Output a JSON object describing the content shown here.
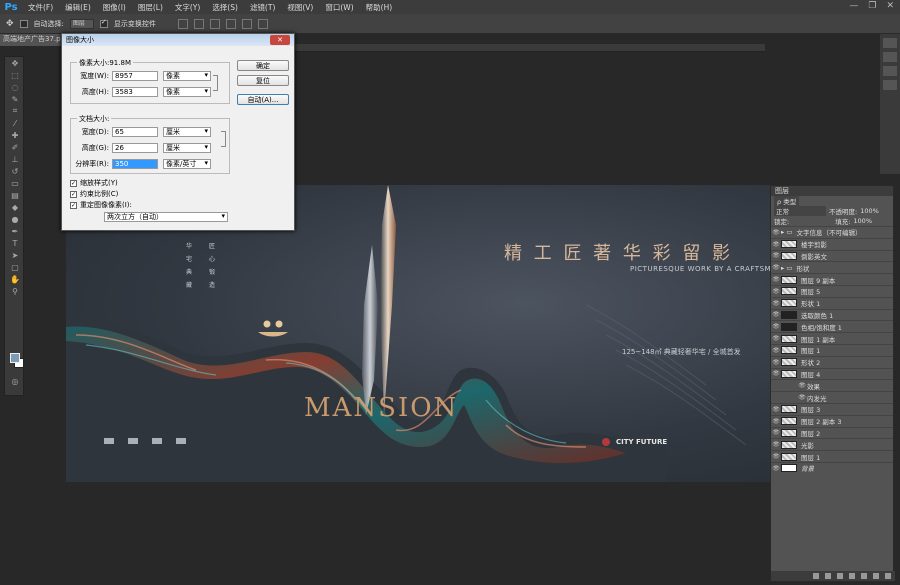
{
  "menubar": {
    "logo": "Ps",
    "items": [
      "文件(F)",
      "编辑(E)",
      "图像(I)",
      "图层(L)",
      "文字(Y)",
      "选择(S)",
      "滤镜(T)",
      "视图(V)",
      "窗口(W)",
      "帮助(H)"
    ],
    "window_buttons": [
      "—",
      "❐",
      "✕"
    ]
  },
  "optbar": {
    "auto_select_label": "自动选择:",
    "auto_select_value": "图层",
    "show_transform_label": "显示变换控件"
  },
  "document_tab": "高端地产广告37.psd",
  "dialog": {
    "title": "图像大小",
    "close": "✕",
    "pixel_dims_label": "像素大小:91.8M",
    "width_label": "宽度(W):",
    "width_value": "8957",
    "width_unit": "像素",
    "height_label": "高度(H):",
    "height_value": "3583",
    "height_unit": "像素",
    "doc_size_label": "文档大小:",
    "doc_width_label": "宽度(D):",
    "doc_width_value": "65",
    "doc_width_unit": "厘米",
    "doc_height_label": "高度(G):",
    "doc_height_value": "26",
    "doc_height_unit": "厘米",
    "res_label": "分辨率(R):",
    "res_value": "350",
    "res_unit": "像素/英寸",
    "scale_styles": "缩放样式(Y)",
    "constrain": "约束比例(C)",
    "resample": "重定图像像素(I):",
    "resample_method": "两次立方（自动）",
    "ok": "确定",
    "reset": "复位",
    "auto": "自动(A)..."
  },
  "artwork": {
    "headline": "精 工 匠 著   华 彩 留 影",
    "subline": "PICTURESQUE WORK BY A CRAFTSMAN",
    "mansion_word": "MANSION",
    "area_text": "125~148㎡ 典藏轻奢华宅 / 全城首发",
    "brand": "CITY FUTURE",
    "vertical_left": [
      "华",
      "宅",
      "典",
      "藏"
    ],
    "vertical_right": [
      "匠",
      "心",
      "锻",
      "造"
    ]
  },
  "layers_panel": {
    "tab": "图层",
    "kind_label": "ρ 类型",
    "blend_mode": "正常",
    "opacity_label": "不透明度:",
    "opacity_value": "100%",
    "lock_label": "锁定:",
    "fill_label": "填充:",
    "fill_value": "100%",
    "layers": [
      {
        "name": "文字信息（不可编辑）",
        "kind": "folder"
      },
      {
        "name": "楼宇剪影",
        "kind": "layer"
      },
      {
        "name": "倒影英文",
        "kind": "layer"
      },
      {
        "name": "形状",
        "kind": "folder"
      },
      {
        "name": "图层 9 副本",
        "kind": "layer"
      },
      {
        "name": "图层 5",
        "kind": "layer"
      },
      {
        "name": "形状 1",
        "kind": "layer"
      },
      {
        "name": "选取颜色 1",
        "kind": "adjust"
      },
      {
        "name": "色相/饱和度 1",
        "kind": "adjust"
      },
      {
        "name": "图层 1 副本",
        "kind": "layer"
      },
      {
        "name": "图层 1",
        "kind": "layer"
      },
      {
        "name": "形状 2",
        "kind": "layer"
      },
      {
        "name": "图层 4",
        "kind": "layer"
      },
      {
        "name": "效果",
        "kind": "effect"
      },
      {
        "name": "内发光",
        "kind": "effect"
      },
      {
        "name": "图层 3",
        "kind": "layer"
      },
      {
        "name": "图层 2 副本 3",
        "kind": "layer"
      },
      {
        "name": "图层 2",
        "kind": "layer"
      },
      {
        "name": "光影",
        "kind": "layer"
      },
      {
        "name": "图层 1",
        "kind": "layer"
      },
      {
        "name": "背景",
        "kind": "background"
      }
    ]
  }
}
